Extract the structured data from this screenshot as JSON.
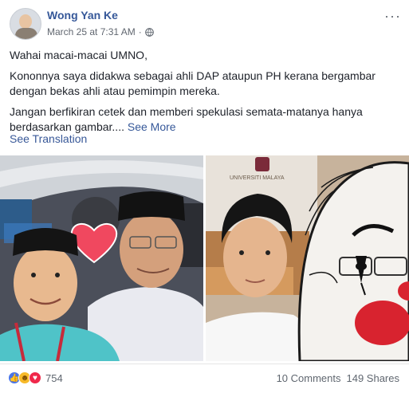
{
  "post": {
    "author": "Wong Yan Ke",
    "timestamp": "March 25 at 7:31 AM",
    "dot": "·",
    "privacy_icon": "globe-icon",
    "more_icon": "more-options-icon",
    "more_glyph": "···",
    "paragraphs": [
      "Wahai macai-macai UMNO,",
      "Kononnya saya didakwa sebagai ahli DAP ataupun PH kerana bergambar dengan bekas ahli atau pemimpin mereka.",
      "Jangan berfikiran cetek dan memberi spekulasi semata-matanya hanya berdasarkan gambar...."
    ],
    "see_more": "See More",
    "see_translation": "See Translation",
    "photos": {
      "right_sign_text": "UNIVERSITI MALAYA"
    },
    "reactions": {
      "icons": [
        "like-icon",
        "haha-icon",
        "love-icon"
      ],
      "count": "754"
    },
    "comments": "10 Comments",
    "shares": "149 Shares"
  },
  "colors": {
    "link": "#365899",
    "meta": "#616770",
    "like": "#4a76e8",
    "haha": "#f7b928",
    "love": "#f0284a"
  }
}
